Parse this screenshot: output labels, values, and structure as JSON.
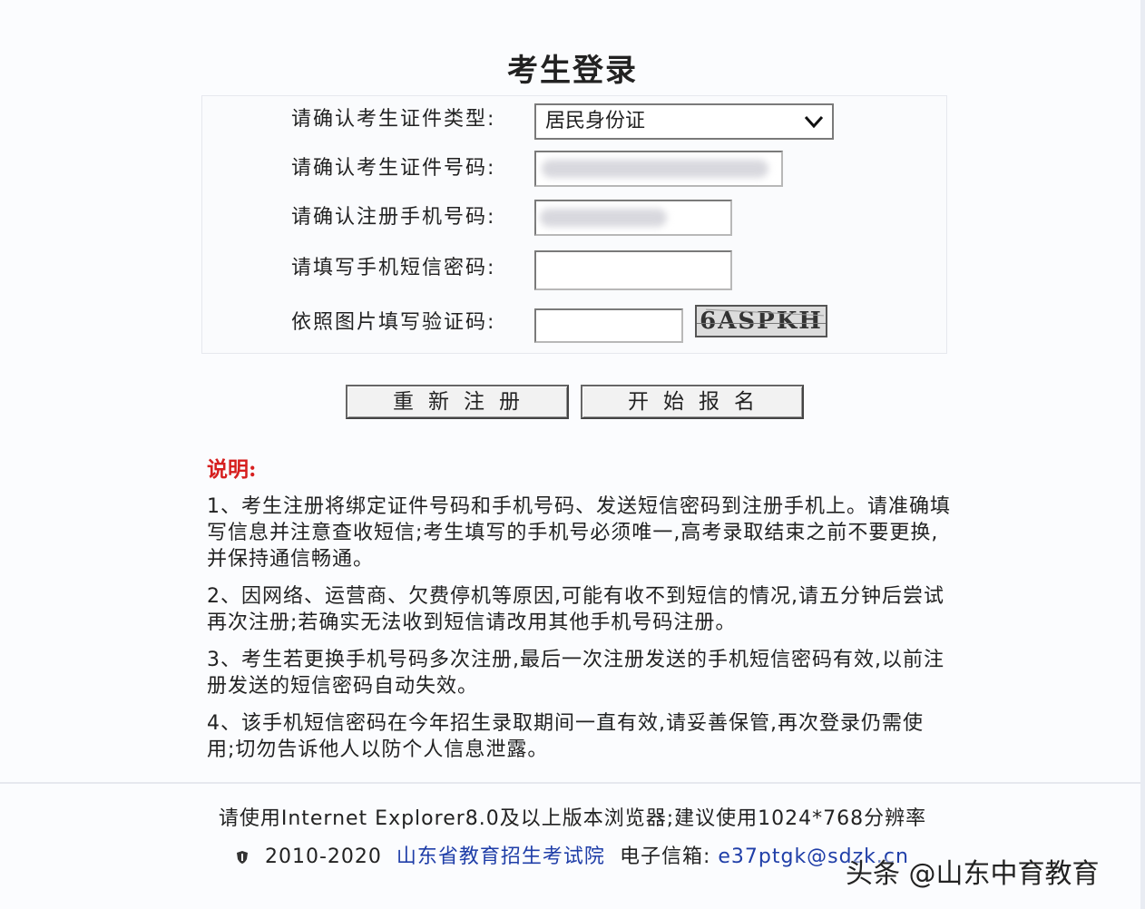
{
  "title": "考生登录",
  "form": {
    "id_type_label": "请确认考生证件类型:",
    "id_type_value": "居民身份证",
    "id_number_label": "请确认考生证件号码:",
    "phone_label": "请确认注册手机号码:",
    "sms_label": "请填写手机短信密码:",
    "captcha_label": "依照图片填写验证码:",
    "captcha_image_text": "6ASPKH"
  },
  "buttons": {
    "reset": "重新注册",
    "start": "开始报名"
  },
  "notes": {
    "heading": "说明:",
    "items": [
      "1、考生注册将绑定证件号码和手机号码、发送短信密码到注册手机上。请准确填写信息并注意查收短信;考生填写的手机号必须唯一,高考录取结束之前不要更换,并保持通信畅通。",
      "2、因网络、运营商、欠费停机等原因,可能有收不到短信的情况,请五分钟后尝试再次注册;若确实无法收到短信请改用其他手机号码注册。",
      "3、考生若更换手机号码多次注册,最后一次注册发送的手机短信密码有效,以前注册发送的短信密码自动失效。",
      "4、该手机短信密码在今年招生录取期间一直有效,请妥善保管,再次登录仍需使用;切勿告诉他人以防个人信息泄露。"
    ]
  },
  "footer": {
    "browser_note": "请使用Internet Explorer8.0及以上版本浏览器;建议使用1024*768分辨率",
    "copyright_years": "2010-2020",
    "org_name": "山东省教育招生考试院",
    "email_label": "电子信箱:",
    "email_value": "e37ptgk@sdzk.cn"
  },
  "watermark": "头条 @山东中育教育",
  "colors": {
    "note_heading": "#d61f1f",
    "link": "#1f3ea8",
    "background": "#fbfcfe"
  }
}
